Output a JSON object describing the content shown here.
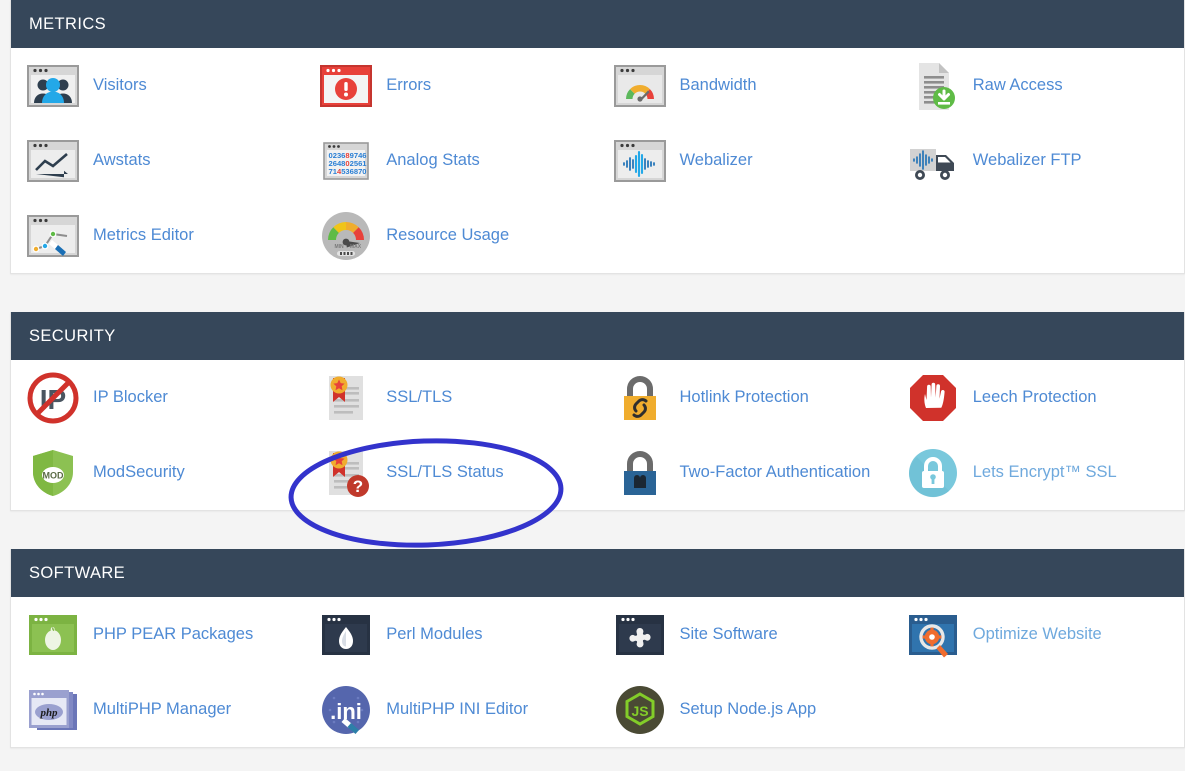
{
  "theme": {
    "header_bg": "#36475a",
    "header_text": "#ffffff",
    "link_color": "#4e8ad4",
    "page_bg": "#f4f4f4",
    "card_bg": "#ffffff",
    "annotation_color": "#3333cc"
  },
  "sections": [
    {
      "title": "METRICS",
      "items": [
        {
          "label": "Visitors",
          "icon": "visitors-icon"
        },
        {
          "label": "Errors",
          "icon": "errors-icon"
        },
        {
          "label": "Bandwidth",
          "icon": "bandwidth-icon"
        },
        {
          "label": "Raw Access",
          "icon": "raw-access-icon"
        },
        {
          "label": "Awstats",
          "icon": "awstats-icon"
        },
        {
          "label": "Analog Stats",
          "icon": "analog-stats-icon"
        },
        {
          "label": "Webalizer",
          "icon": "webalizer-icon"
        },
        {
          "label": "Webalizer FTP",
          "icon": "webalizer-ftp-icon"
        },
        {
          "label": "Metrics Editor",
          "icon": "metrics-editor-icon"
        },
        {
          "label": "Resource Usage",
          "icon": "resource-usage-icon"
        }
      ]
    },
    {
      "title": "SECURITY",
      "items": [
        {
          "label": "IP Blocker",
          "icon": "ip-blocker-icon"
        },
        {
          "label": "SSL/TLS",
          "icon": "ssl-tls-icon"
        },
        {
          "label": "Hotlink Protection",
          "icon": "hotlink-protection-icon"
        },
        {
          "label": "Leech Protection",
          "icon": "leech-protection-icon"
        },
        {
          "label": "ModSecurity",
          "icon": "modsecurity-icon"
        },
        {
          "label": "SSL/TLS Status",
          "icon": "ssl-tls-status-icon"
        },
        {
          "label": "Two-Factor Authentication",
          "icon": "two-factor-auth-icon"
        },
        {
          "label": "Lets Encrypt™ SSL",
          "icon": "lets-encrypt-icon"
        }
      ]
    },
    {
      "title": "SOFTWARE",
      "items": [
        {
          "label": "PHP PEAR Packages",
          "icon": "php-pear-icon"
        },
        {
          "label": "Perl Modules",
          "icon": "perl-modules-icon"
        },
        {
          "label": "Site Software",
          "icon": "site-software-icon"
        },
        {
          "label": "Optimize Website",
          "icon": "optimize-website-icon"
        },
        {
          "label": "MultiPHP Manager",
          "icon": "multiphp-manager-icon"
        },
        {
          "label": "MultiPHP INI Editor",
          "icon": "multiphp-ini-editor-icon"
        },
        {
          "label": "Setup Node.js App",
          "icon": "setup-nodejs-icon"
        }
      ]
    }
  ],
  "icon_text": {
    "analog_stats_rows": [
      "023689746",
      "264802561",
      "714536870"
    ],
    "modsecurity_label": "MOD",
    "ip_blocker_label": "IP",
    "gauge_min": "MIN",
    "gauge_max": "MAX",
    "php_label": "php",
    "ini_label": ".ini",
    "nodejs_label": "JS"
  },
  "annotation": {
    "shape": "ellipse",
    "target_label": "SSL/TLS Status",
    "color": "#3333cc",
    "stroke_width": 5
  }
}
